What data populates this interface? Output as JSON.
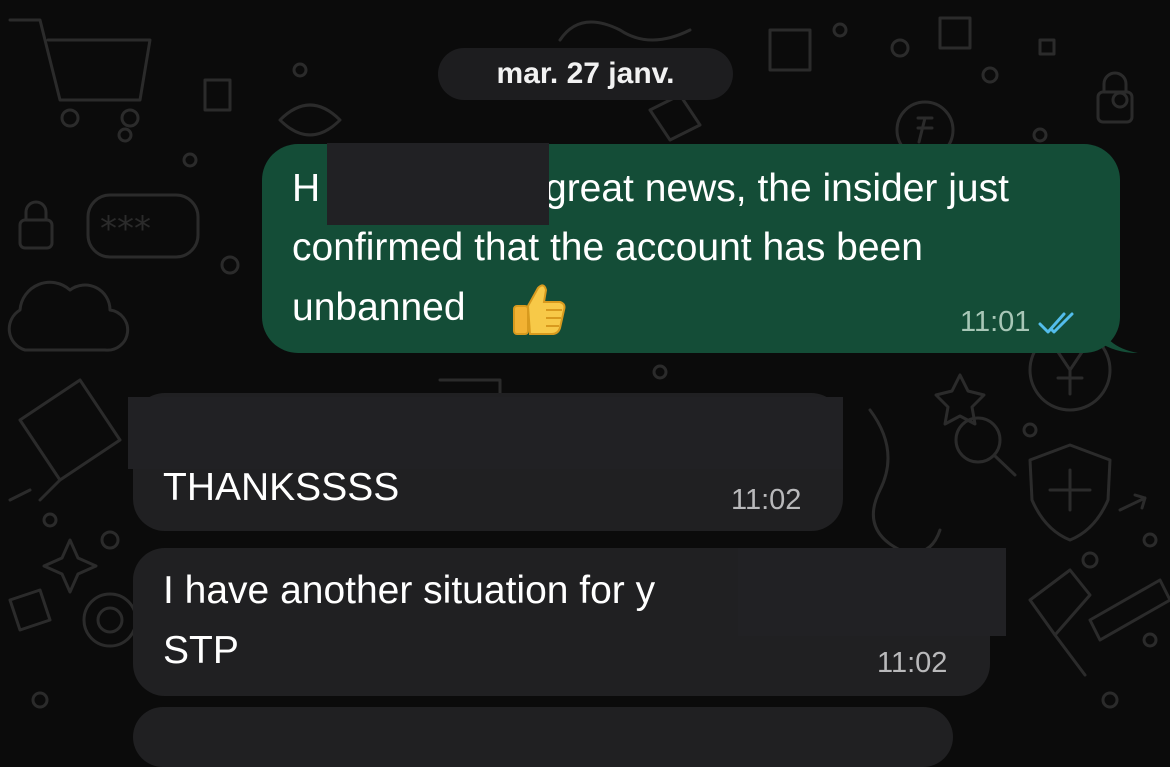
{
  "date_separator": "mar. 27 janv.",
  "messages": [
    {
      "direction": "outgoing",
      "line1_start": "H",
      "line1_end": "great news, the insider just",
      "line2": "confirmed that the account has been",
      "line3": "unbanned",
      "emoji_icon": "thumbs-up-icon",
      "time": "11:01",
      "status_icon": "double-check-icon",
      "status_color": "#53bdeb"
    },
    {
      "direction": "incoming",
      "text": "THANKSSSS",
      "time": "11:02"
    },
    {
      "direction": "incoming",
      "line1": "I have another situation for y",
      "line2": "STP",
      "time": "11:02"
    }
  ],
  "colors": {
    "background": "#0b0b0b",
    "outgoing_bubble": "#144d37",
    "incoming_bubble": "#202022",
    "date_pill": "#1d1d1f"
  }
}
